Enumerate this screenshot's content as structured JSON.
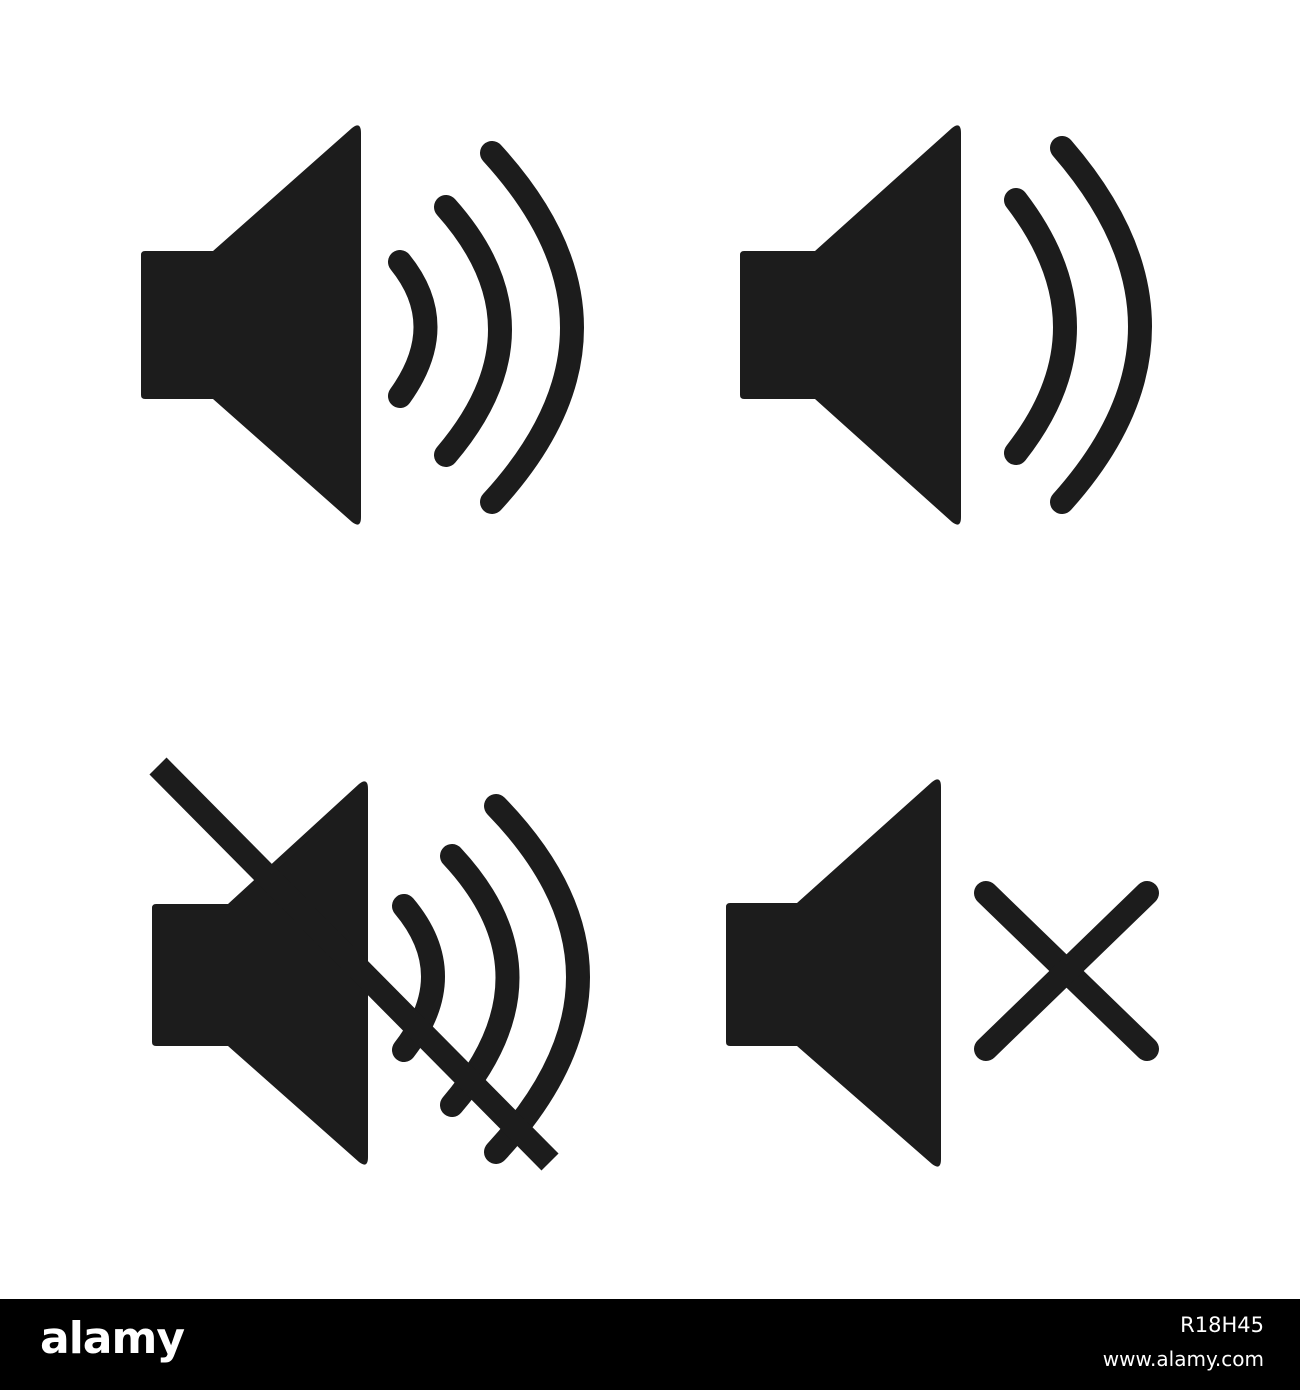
{
  "icons": [
    {
      "name": "volume-high-icon",
      "waves": 3,
      "muted": false
    },
    {
      "name": "volume-medium-icon",
      "waves": 2,
      "muted": false
    },
    {
      "name": "volume-off-slash-icon",
      "waves": 3,
      "muted": true,
      "mute_style": "slash"
    },
    {
      "name": "volume-mute-x-icon",
      "waves": 0,
      "muted": true,
      "mute_style": "cross"
    }
  ],
  "colors": {
    "icon": "#1c1c1c",
    "background": "#ffffff",
    "footer": "#000000",
    "footer_text": "#ffffff"
  },
  "footer": {
    "logo": "alamy",
    "image_id": "R18H45",
    "url": "www.alamy.com"
  }
}
